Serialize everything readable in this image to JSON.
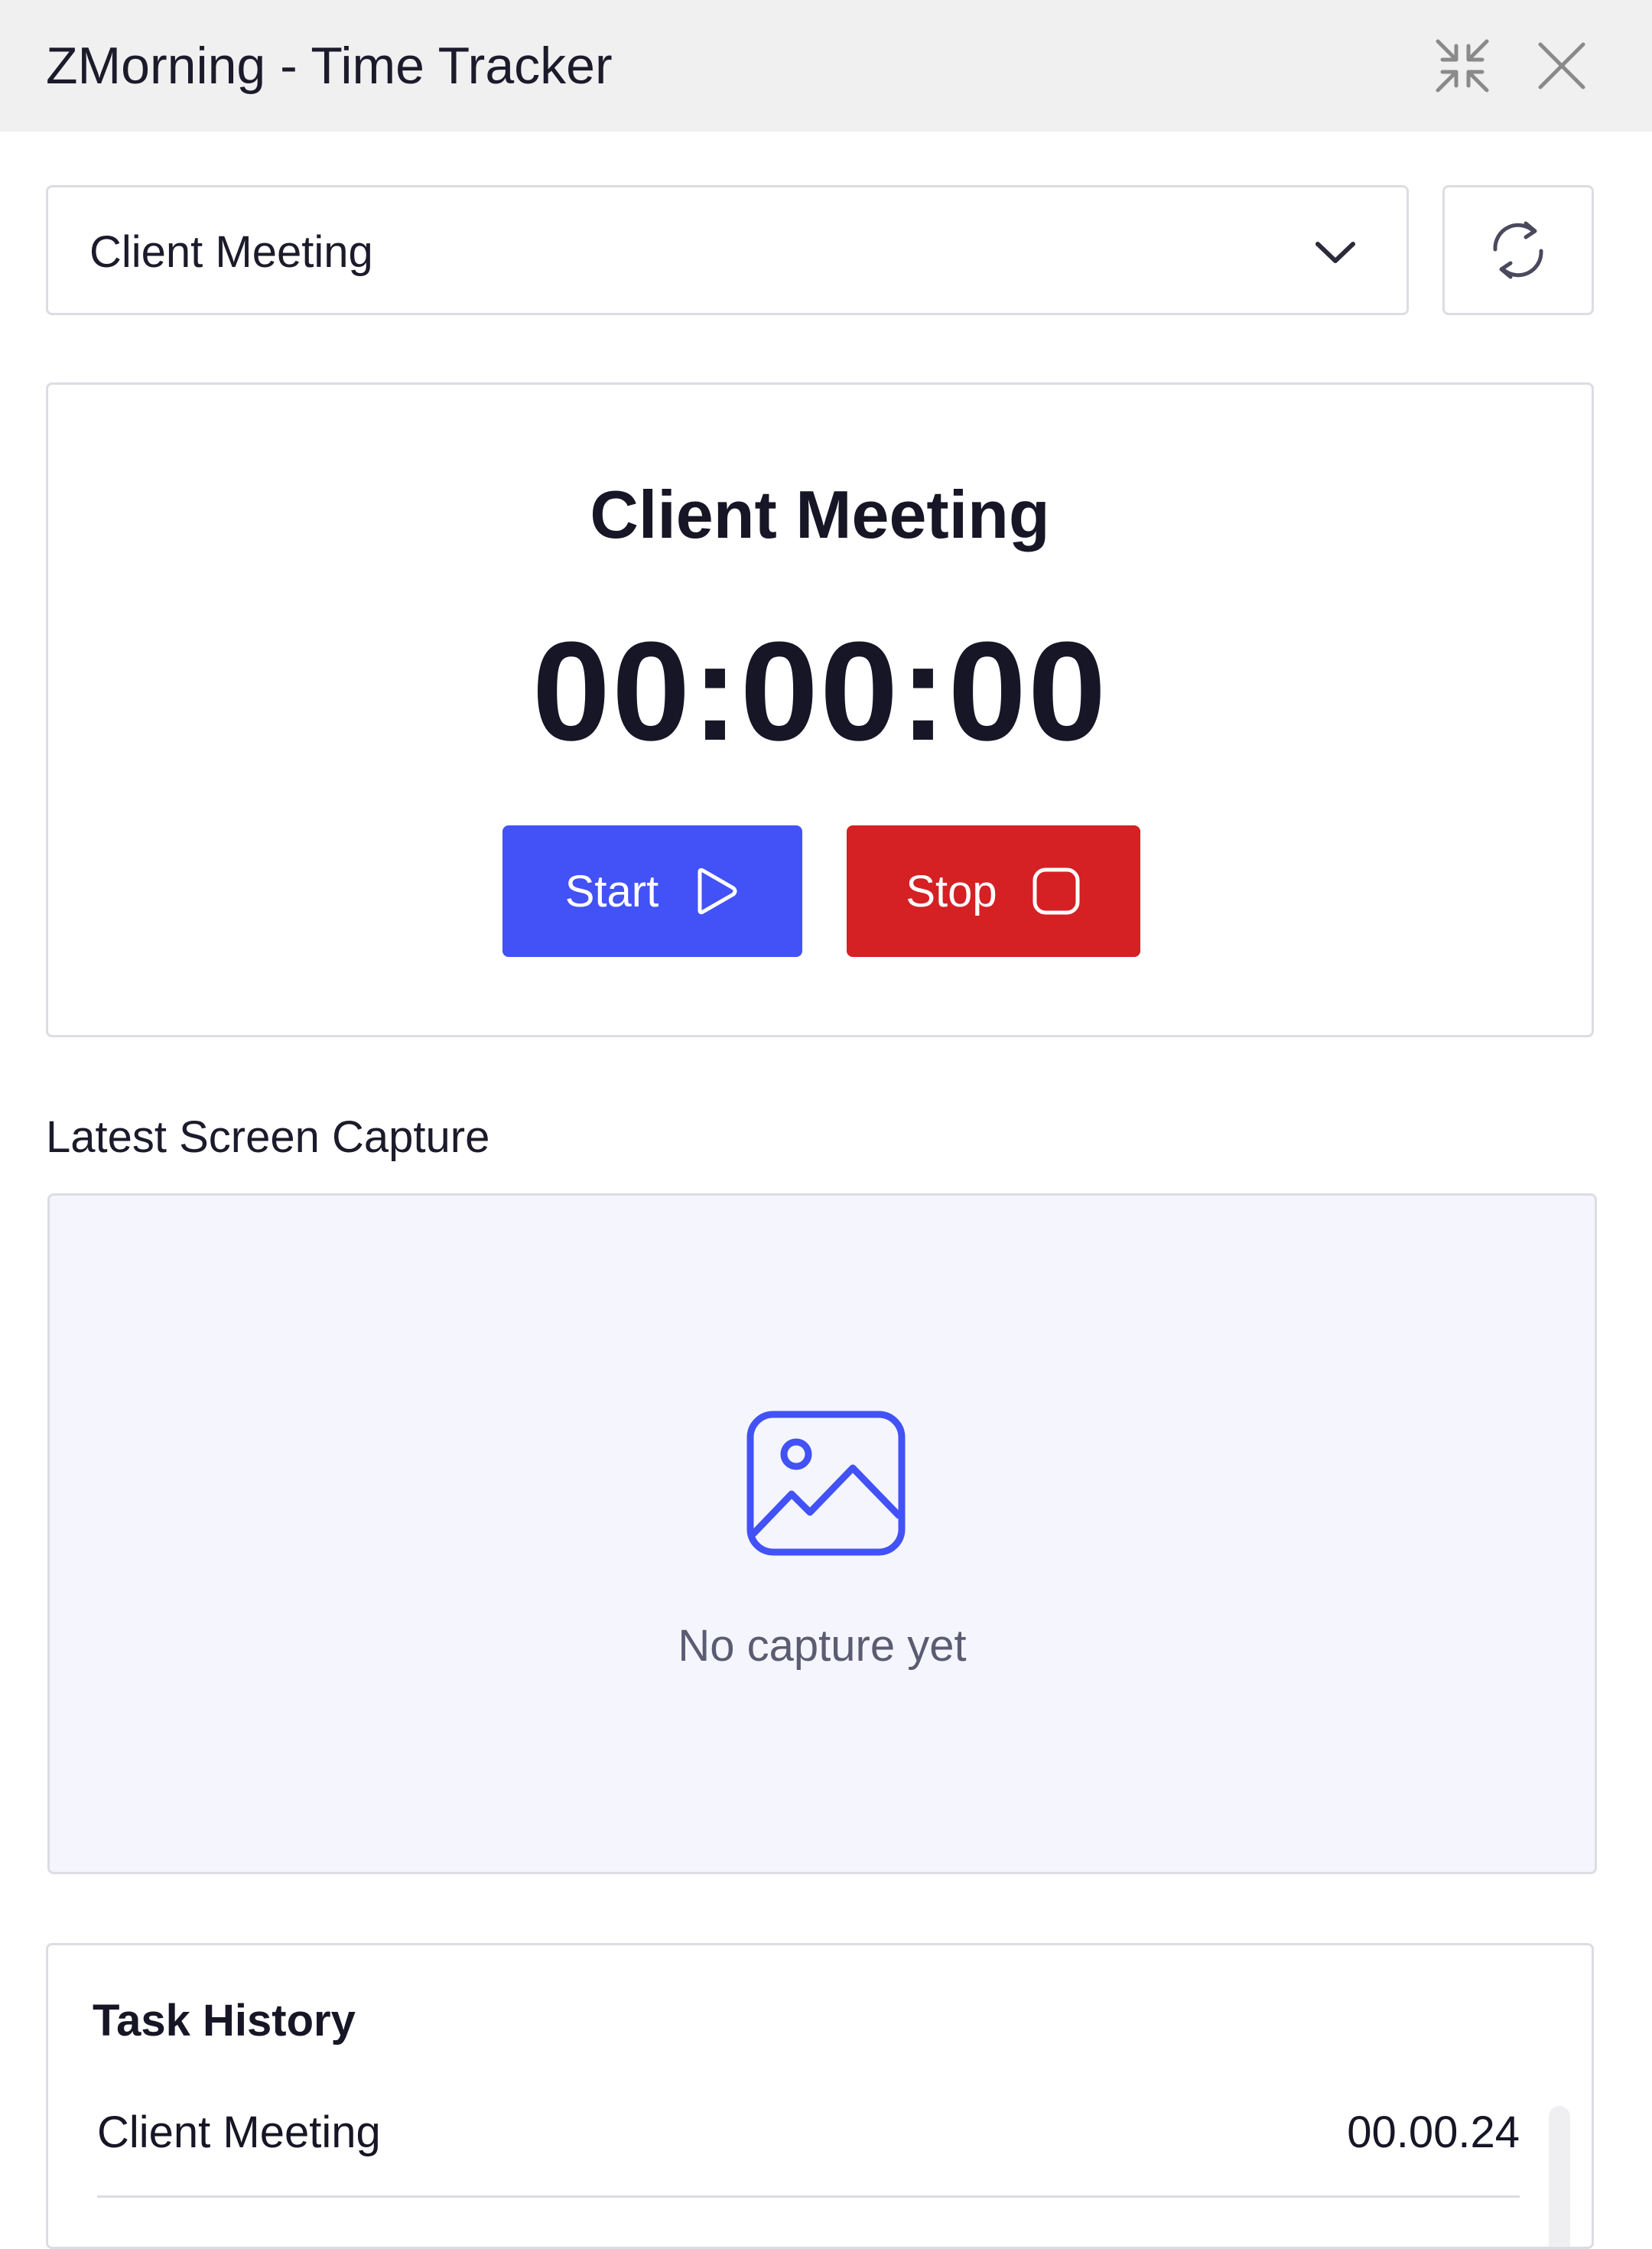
{
  "window": {
    "title": "ZMorning - Time Tracker",
    "minimize_icon": "collapse-arrows-icon",
    "close_icon": "close-icon"
  },
  "task_selector": {
    "selected": "Client Meeting",
    "chevron_icon": "chevron-down-icon",
    "refresh_icon": "refresh-icon"
  },
  "timer": {
    "task_name": "Client Meeting",
    "elapsed": "00:00:00",
    "start_label": "Start",
    "start_icon": "play-icon",
    "stop_label": "Stop",
    "stop_icon": "stop-icon"
  },
  "screen_capture": {
    "label": "Latest Screen Capture",
    "placeholder_icon": "image-icon",
    "empty_text": "No capture yet"
  },
  "task_history": {
    "heading": "Task History",
    "entries": [
      {
        "name": "Client Meeting",
        "duration": "00.00.24"
      }
    ]
  },
  "colors": {
    "titlebar_bg": "#f0f0f0",
    "start_button": "#4252f6",
    "stop_button": "#d52024",
    "capture_bg": "#f5f6fd",
    "icon_accent": "#4252f6",
    "border": "#dcdde3"
  }
}
